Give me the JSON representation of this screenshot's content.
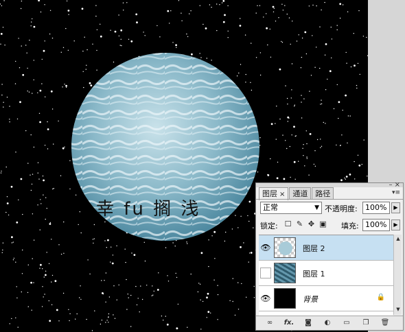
{
  "canvas": {
    "text": "幸 fu 搁 浅"
  },
  "layers_panel": {
    "tabs": [
      {
        "label": "图层",
        "close": "×"
      },
      {
        "label": "通道"
      },
      {
        "label": "路径"
      }
    ],
    "blend_mode": "正常",
    "opacity_label": "不透明度:",
    "opacity_value": "100%",
    "lock_label": "锁定:",
    "fill_label": "填充:",
    "fill_value": "100%",
    "layers": [
      {
        "name": "图层 2",
        "visible": true,
        "selected": true
      },
      {
        "name": "图层 1",
        "visible": false,
        "selected": false
      },
      {
        "name": "背景",
        "visible": true,
        "selected": false,
        "locked": true
      }
    ],
    "bottom_icons": [
      "link-icon",
      "fx-icon",
      "mask-icon",
      "adjustment-icon",
      "folder-icon",
      "new-layer-icon",
      "trash-icon"
    ],
    "fx_label": "fx."
  },
  "colors": {
    "selection": "#c6e0f2",
    "panel_bg": "#f0f0f0",
    "planet": "#6fa3b8"
  }
}
